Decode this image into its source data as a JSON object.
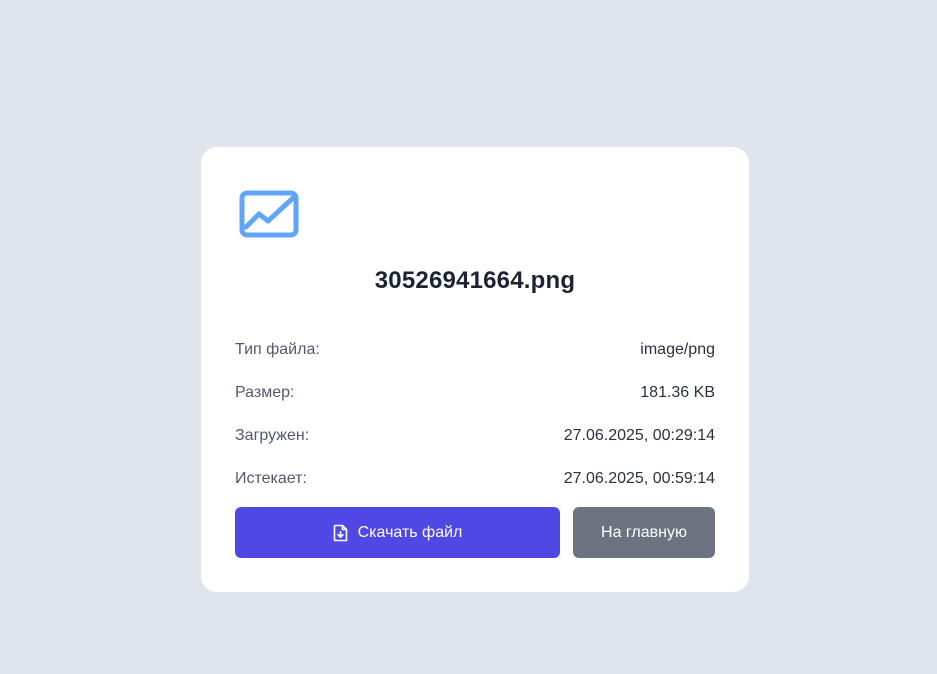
{
  "file": {
    "icon": "image-file-icon",
    "name": "30526941664.png"
  },
  "details": [
    {
      "label": "Тип файла:",
      "value": "image/png"
    },
    {
      "label": "Размер:",
      "value": "181.36 KB"
    },
    {
      "label": "Загружен:",
      "value": "27.06.2025, 00:29:14"
    },
    {
      "label": "Истекает:",
      "value": "27.06.2025, 00:59:14"
    }
  ],
  "actions": {
    "download_label": "Скачать файл",
    "download_icon": "file-download-icon",
    "home_label": "На главную"
  },
  "colors": {
    "background": "#e0e4ec",
    "card": "#ffffff",
    "accent": "#5048e5",
    "secondary": "#6c7280",
    "icon": "#60a5fa"
  }
}
